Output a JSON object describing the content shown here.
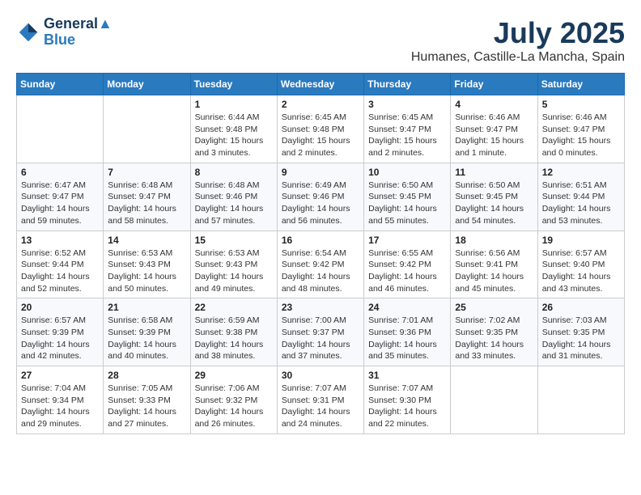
{
  "header": {
    "logo_line1": "General",
    "logo_line2": "Blue",
    "month": "July 2025",
    "location": "Humanes, Castille-La Mancha, Spain"
  },
  "weekdays": [
    "Sunday",
    "Monday",
    "Tuesday",
    "Wednesday",
    "Thursday",
    "Friday",
    "Saturday"
  ],
  "weeks": [
    [
      {
        "day": "",
        "info": ""
      },
      {
        "day": "",
        "info": ""
      },
      {
        "day": "1",
        "info": "Sunrise: 6:44 AM\nSunset: 9:48 PM\nDaylight: 15 hours and 3 minutes."
      },
      {
        "day": "2",
        "info": "Sunrise: 6:45 AM\nSunset: 9:48 PM\nDaylight: 15 hours and 2 minutes."
      },
      {
        "day": "3",
        "info": "Sunrise: 6:45 AM\nSunset: 9:47 PM\nDaylight: 15 hours and 2 minutes."
      },
      {
        "day": "4",
        "info": "Sunrise: 6:46 AM\nSunset: 9:47 PM\nDaylight: 15 hours and 1 minute."
      },
      {
        "day": "5",
        "info": "Sunrise: 6:46 AM\nSunset: 9:47 PM\nDaylight: 15 hours and 0 minutes."
      }
    ],
    [
      {
        "day": "6",
        "info": "Sunrise: 6:47 AM\nSunset: 9:47 PM\nDaylight: 14 hours and 59 minutes."
      },
      {
        "day": "7",
        "info": "Sunrise: 6:48 AM\nSunset: 9:47 PM\nDaylight: 14 hours and 58 minutes."
      },
      {
        "day": "8",
        "info": "Sunrise: 6:48 AM\nSunset: 9:46 PM\nDaylight: 14 hours and 57 minutes."
      },
      {
        "day": "9",
        "info": "Sunrise: 6:49 AM\nSunset: 9:46 PM\nDaylight: 14 hours and 56 minutes."
      },
      {
        "day": "10",
        "info": "Sunrise: 6:50 AM\nSunset: 9:45 PM\nDaylight: 14 hours and 55 minutes."
      },
      {
        "day": "11",
        "info": "Sunrise: 6:50 AM\nSunset: 9:45 PM\nDaylight: 14 hours and 54 minutes."
      },
      {
        "day": "12",
        "info": "Sunrise: 6:51 AM\nSunset: 9:44 PM\nDaylight: 14 hours and 53 minutes."
      }
    ],
    [
      {
        "day": "13",
        "info": "Sunrise: 6:52 AM\nSunset: 9:44 PM\nDaylight: 14 hours and 52 minutes."
      },
      {
        "day": "14",
        "info": "Sunrise: 6:53 AM\nSunset: 9:43 PM\nDaylight: 14 hours and 50 minutes."
      },
      {
        "day": "15",
        "info": "Sunrise: 6:53 AM\nSunset: 9:43 PM\nDaylight: 14 hours and 49 minutes."
      },
      {
        "day": "16",
        "info": "Sunrise: 6:54 AM\nSunset: 9:42 PM\nDaylight: 14 hours and 48 minutes."
      },
      {
        "day": "17",
        "info": "Sunrise: 6:55 AM\nSunset: 9:42 PM\nDaylight: 14 hours and 46 minutes."
      },
      {
        "day": "18",
        "info": "Sunrise: 6:56 AM\nSunset: 9:41 PM\nDaylight: 14 hours and 45 minutes."
      },
      {
        "day": "19",
        "info": "Sunrise: 6:57 AM\nSunset: 9:40 PM\nDaylight: 14 hours and 43 minutes."
      }
    ],
    [
      {
        "day": "20",
        "info": "Sunrise: 6:57 AM\nSunset: 9:39 PM\nDaylight: 14 hours and 42 minutes."
      },
      {
        "day": "21",
        "info": "Sunrise: 6:58 AM\nSunset: 9:39 PM\nDaylight: 14 hours and 40 minutes."
      },
      {
        "day": "22",
        "info": "Sunrise: 6:59 AM\nSunset: 9:38 PM\nDaylight: 14 hours and 38 minutes."
      },
      {
        "day": "23",
        "info": "Sunrise: 7:00 AM\nSunset: 9:37 PM\nDaylight: 14 hours and 37 minutes."
      },
      {
        "day": "24",
        "info": "Sunrise: 7:01 AM\nSunset: 9:36 PM\nDaylight: 14 hours and 35 minutes."
      },
      {
        "day": "25",
        "info": "Sunrise: 7:02 AM\nSunset: 9:35 PM\nDaylight: 14 hours and 33 minutes."
      },
      {
        "day": "26",
        "info": "Sunrise: 7:03 AM\nSunset: 9:35 PM\nDaylight: 14 hours and 31 minutes."
      }
    ],
    [
      {
        "day": "27",
        "info": "Sunrise: 7:04 AM\nSunset: 9:34 PM\nDaylight: 14 hours and 29 minutes."
      },
      {
        "day": "28",
        "info": "Sunrise: 7:05 AM\nSunset: 9:33 PM\nDaylight: 14 hours and 27 minutes."
      },
      {
        "day": "29",
        "info": "Sunrise: 7:06 AM\nSunset: 9:32 PM\nDaylight: 14 hours and 26 minutes."
      },
      {
        "day": "30",
        "info": "Sunrise: 7:07 AM\nSunset: 9:31 PM\nDaylight: 14 hours and 24 minutes."
      },
      {
        "day": "31",
        "info": "Sunrise: 7:07 AM\nSunset: 9:30 PM\nDaylight: 14 hours and 22 minutes."
      },
      {
        "day": "",
        "info": ""
      },
      {
        "day": "",
        "info": ""
      }
    ]
  ]
}
